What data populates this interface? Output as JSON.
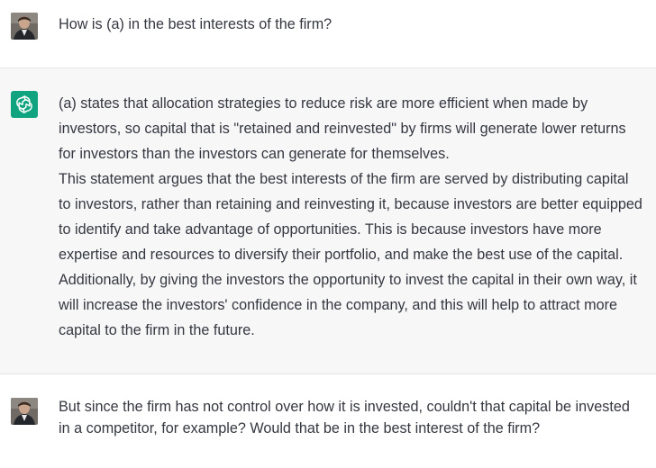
{
  "conversation": {
    "messages": [
      {
        "role": "user",
        "text": "How is (a) in the best interests of the firm?"
      },
      {
        "role": "assistant",
        "paragraphs": [
          "(a) states that allocation strategies to reduce risk are more efficient when made by investors, so capital that is \"retained and reinvested\" by firms will generate lower returns for investors than the investors can generate for themselves.",
          "This statement argues that the best interests of the firm are served by distributing capital to investors, rather than retaining and reinvesting it, because investors are better equipped to identify and take advantage of opportunities. This is because investors have more expertise and resources to diversify their portfolio, and make the best use of the capital. Additionally, by giving the investors the opportunity to invest the capital in their own way, it will increase the investors' confidence in the company, and this will help to attract more capital to the firm in the future."
        ]
      },
      {
        "role": "user",
        "text": "But since the firm has not control over how it is invested, couldn't that capital be invested in a competitor, for example? Would that be in the best interest of the firm?"
      }
    ]
  },
  "colors": {
    "assistant_bg": "#f7f7f8",
    "gpt_brand": "#10a37f",
    "text": "#353740"
  },
  "icons": {
    "user_avatar": "user-avatar-photo",
    "assistant_avatar": "openai-logo-icon"
  }
}
